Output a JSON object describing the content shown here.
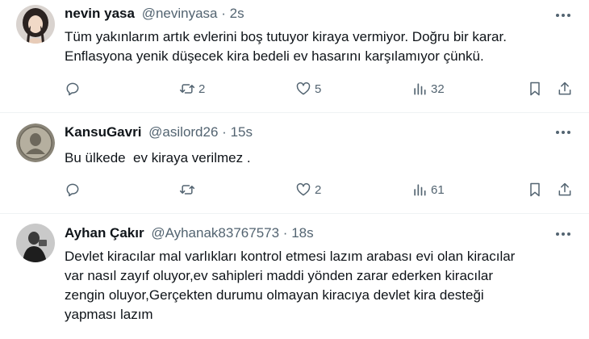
{
  "tweets": [
    {
      "name": "nevin yasa",
      "handle": "@nevinyasa",
      "dot": "·",
      "time": "2s",
      "text_lines": [
        "Tüm yakınlarım artık evlerini boş tutuyor kiraya vermiyor. Doğru bir karar.",
        "Enflasyona yenik düşecek kira bedeli ev hasarını karşılamıyor çünkü."
      ],
      "replies": "",
      "retweets": "2",
      "likes": "5",
      "views": "32"
    },
    {
      "name": "KansuGavri",
      "handle": "@asilord26",
      "dot": "·",
      "time": "15s",
      "text_lines": [
        "Bu ülkede  ev kiraya verilmez ."
      ],
      "replies": "",
      "retweets": "",
      "likes": "2",
      "views": "61"
    },
    {
      "name": "Ayhan Çakır",
      "handle": "@Ayhanak83767573",
      "dot": "·",
      "time": "18s",
      "text_lines": [
        "Devlet kiracılar mal varlıkları kontrol etmesi lazım arabası evi olan kiracılar",
        "var nasıl zayıf oluyor,ev sahipleri maddi yönden zarar ederken kiracılar",
        "zengin oluyor,Gerçekten durumu olmayan kiracıya devlet kira desteği",
        "yapması lazım"
      ]
    }
  ],
  "icons": {
    "more": "more-horizontal-icon",
    "reply": "reply-icon",
    "retweet": "retweet-icon",
    "like": "heart-icon",
    "views": "analytics-icon",
    "bookmark": "bookmark-icon",
    "share": "share-icon"
  },
  "colors": {
    "text": "#0f1419",
    "secondary": "#536471",
    "divider": "#eff3f4"
  }
}
